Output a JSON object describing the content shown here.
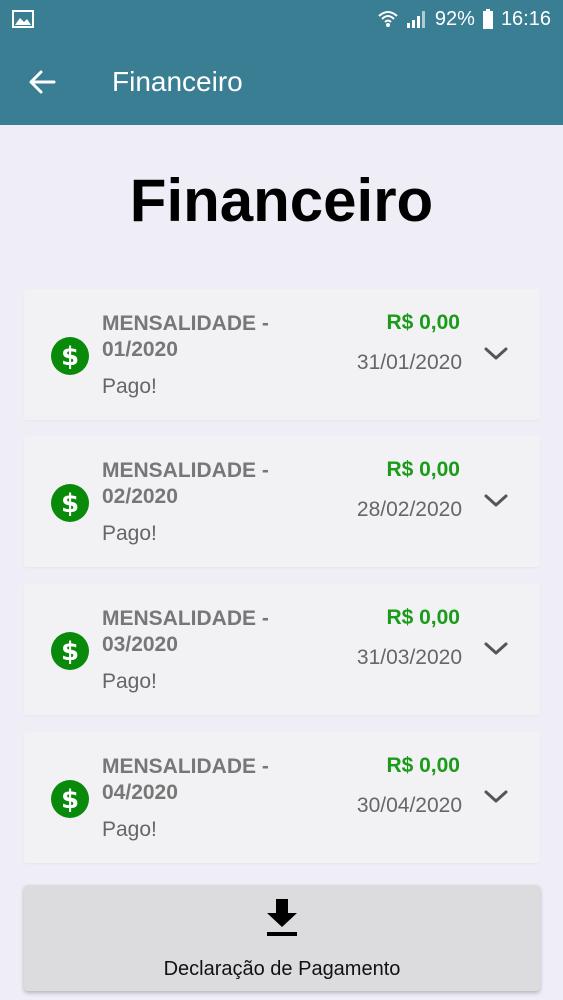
{
  "status_bar": {
    "battery_percent": "92%",
    "time": "16:16",
    "icons": [
      "gallery-icon",
      "wifi-icon",
      "signal-icon",
      "battery-icon"
    ]
  },
  "app_bar": {
    "title": "Financeiro",
    "back_icon": "arrow-back-icon"
  },
  "page": {
    "title": "Financeiro"
  },
  "payments": [
    {
      "title": "MENSALIDADE - 01/2020",
      "status": "Pago!",
      "amount": "R$ 0,00",
      "date": "31/01/2020"
    },
    {
      "title": "MENSALIDADE - 02/2020",
      "status": "Pago!",
      "amount": "R$ 0,00",
      "date": "28/02/2020"
    },
    {
      "title": "MENSALIDADE - 03/2020",
      "status": "Pago!",
      "amount": "R$ 0,00",
      "date": "31/03/2020"
    },
    {
      "title": "MENSALIDADE - 04/2020",
      "status": "Pago!",
      "amount": "R$ 0,00",
      "date": "30/04/2020"
    }
  ],
  "declaration_button": {
    "label": "Declaração de Pagamento",
    "icon": "download-icon"
  },
  "colors": {
    "app_bar": "#3a7e94",
    "background": "#efeef7",
    "card": "#f2f1f4",
    "amount_green": "#1a9b1a",
    "icon_green": "#0a8a0a"
  }
}
